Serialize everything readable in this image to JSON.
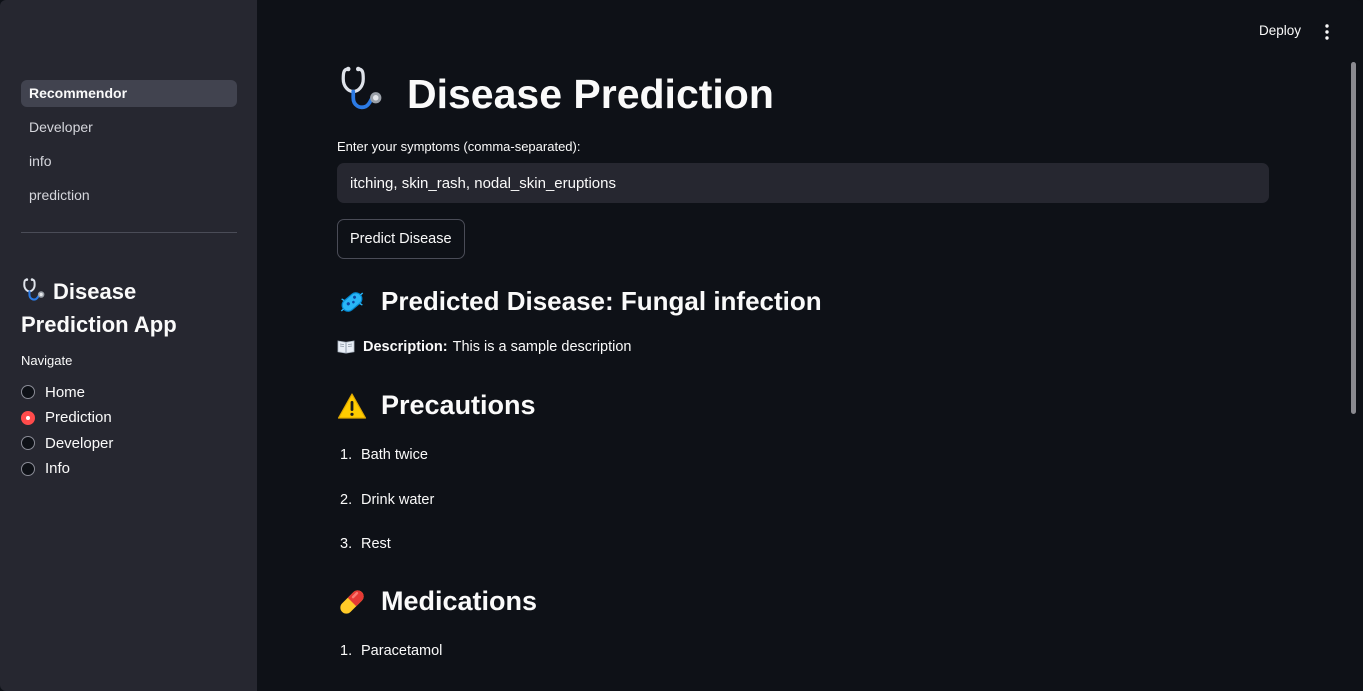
{
  "sidebar": {
    "nav_items": [
      {
        "label": "Recommendor",
        "active": true
      },
      {
        "label": "Developer",
        "active": false
      },
      {
        "label": "info",
        "active": false
      },
      {
        "label": "prediction",
        "active": false
      }
    ],
    "app_title": "Disease Prediction App",
    "navigate_label": "Navigate",
    "radio_options": [
      {
        "label": "Home",
        "checked": false
      },
      {
        "label": "Prediction",
        "checked": true
      },
      {
        "label": "Developer",
        "checked": false
      },
      {
        "label": "Info",
        "checked": false
      }
    ]
  },
  "header": {
    "deploy_label": "Deploy",
    "menu_icon": "more-vertical-icon"
  },
  "main": {
    "title": "Disease Prediction",
    "title_icon": "stethoscope-icon",
    "input_label": "Enter your symptoms (comma-separated):",
    "input_value": "itching, skin_rash, nodal_skin_eruptions",
    "predict_button": "Predict Disease",
    "predicted_heading": "Predicted Disease: Fungal infection",
    "predicted_icon": "microbe-icon",
    "description_label": "Description:",
    "description_text": "This is a sample description",
    "description_icon": "open-book-icon",
    "precautions_heading": "Precautions",
    "precautions_icon": "warning-icon",
    "precautions": [
      {
        "num": "1.",
        "text": "Bath twice"
      },
      {
        "num": "2.",
        "text": "Drink water"
      },
      {
        "num": "3.",
        "text": "Rest"
      }
    ],
    "medications_heading": "Medications",
    "medications_icon": "pill-icon",
    "medications": [
      {
        "num": "1.",
        "text": "Paracetamol"
      }
    ]
  },
  "colors": {
    "background": "#0e1117",
    "sidebar": "#262730",
    "accent": "#ff4b4b",
    "input_bg": "#262730"
  }
}
